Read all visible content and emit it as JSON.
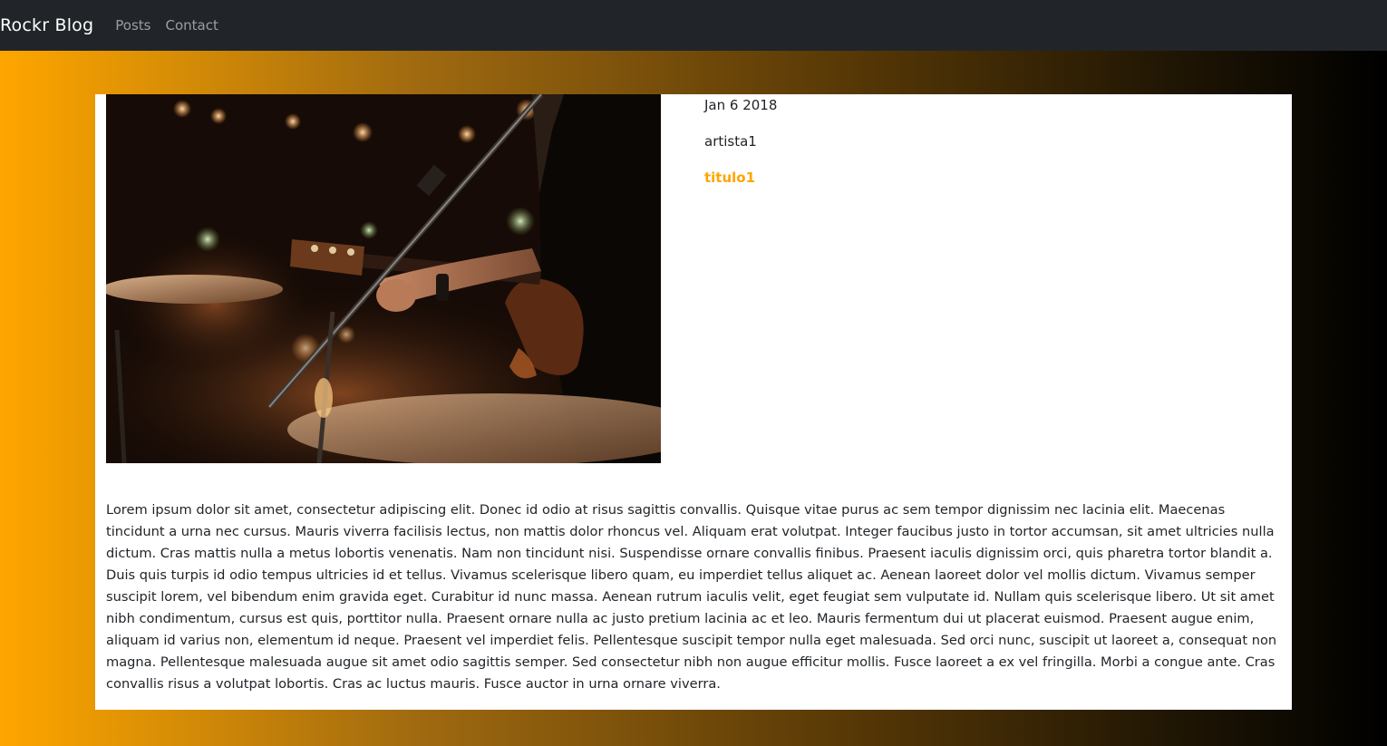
{
  "nav": {
    "brand": "Rockr Blog",
    "links": [
      "Posts",
      "Contact"
    ]
  },
  "post": {
    "date": "Jan 6 2018",
    "artist": "artista1",
    "title": "titulo1",
    "image_subject": "guitarist-performing-image",
    "body": "Lorem ipsum dolor sit amet, consectetur adipiscing elit. Donec id odio at risus sagittis convallis. Quisque vitae purus ac sem tempor dignissim nec lacinia elit. Maecenas tincidunt a urna nec cursus. Mauris viverra facilisis lectus, non mattis dolor rhoncus vel. Aliquam erat volutpat. Integer faucibus justo in tortor accumsan, sit amet ultricies nulla dictum. Cras mattis nulla a metus lobortis venenatis. Nam non tincidunt nisi. Suspendisse ornare convallis finibus. Praesent iaculis dignissim orci, quis pharetra tortor blandit a. Duis quis turpis id odio tempus ultricies id et tellus. Vivamus scelerisque libero quam, eu imperdiet tellus aliquet ac. Aenean laoreet dolor vel mollis dictum. Vivamus semper suscipit lorem, vel bibendum enim gravida eget. Curabitur id nunc massa. Aenean rutrum iaculis velit, eget feugiat sem vulputate id. Nullam quis scelerisque libero. Ut sit amet nibh condimentum, cursus est quis, porttitor nulla. Praesent ornare nulla ac justo pretium lacinia ac et leo. Mauris fermentum dui ut placerat euismod. Praesent augue enim, aliquam id varius non, elementum id neque. Praesent vel imperdiet felis. Pellentesque suscipit tempor nulla eget malesuada. Sed orci nunc, suscipit ut laoreet a, consequat non magna. Pellentesque malesuada augue sit amet odio sagittis semper. Sed consectetur nibh non augue efficitur mollis. Fusce laoreet a ex vel fringilla. Morbi a congue ante. Cras convallis risus a volutpat lobortis. Cras ac luctus mauris. Fusce auctor in urna ornare viverra."
  },
  "colors": {
    "navbar_bg": "#212529",
    "accent": "#ffa500",
    "gradient_start": "#ffa500",
    "gradient_end": "#000000"
  }
}
